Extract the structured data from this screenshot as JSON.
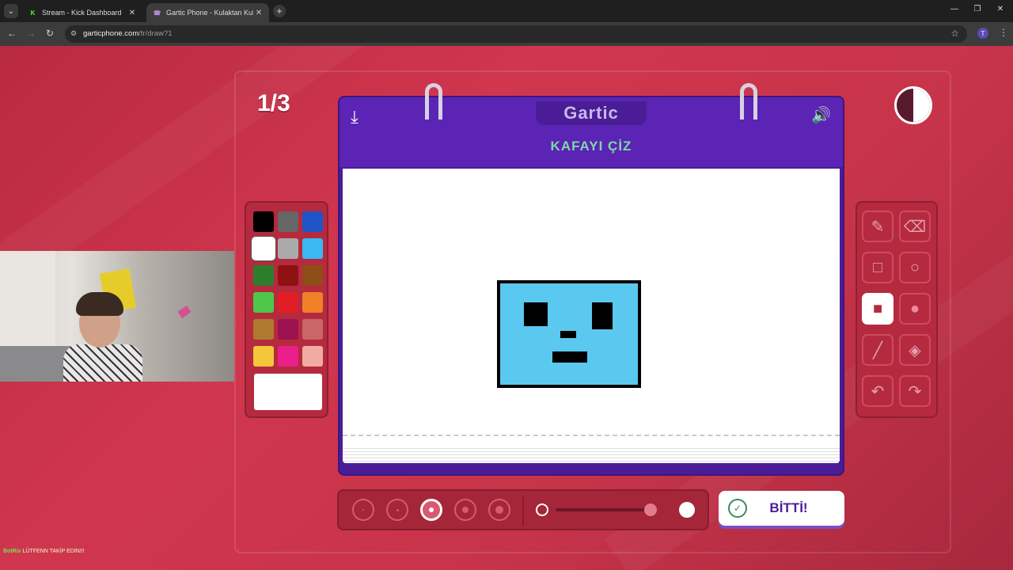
{
  "browser": {
    "tabs": [
      {
        "title": "Stream - Kick Dashboard",
        "favicon": "K",
        "favicon_color": "#53fc18",
        "active": false
      },
      {
        "title": "Gartic Phone - Kulaktan Kulağa",
        "favicon": "☎",
        "favicon_color": "#a98cd6",
        "active": true
      }
    ],
    "url_host": "garticphone.com",
    "url_path": "/tr/draw?1",
    "profile_initial": "T"
  },
  "game": {
    "round": "1/3",
    "logo": "Gartic",
    "prompt": "KAFAYI ÇİZ",
    "done_label": "BİTTİ!",
    "timer_fraction_remaining": 0.5
  },
  "palette": {
    "colors": [
      "#000000",
      "#666666",
      "#1f55c8",
      "#ffffff",
      "#aaaaaa",
      "#39b8f2",
      "#2d7e2c",
      "#8e1212",
      "#8f4d18",
      "#4fc84a",
      "#e21e25",
      "#f08127",
      "#b07a2e",
      "#9c1251",
      "#c96667",
      "#f4c73a",
      "#ec1f8a",
      "#f2aba0"
    ],
    "selected_index": 3,
    "current_color": "#ffffff"
  },
  "tools": {
    "items": [
      "pencil-icon",
      "eraser-icon",
      "rectangle-outline-icon",
      "ellipse-outline-icon",
      "rectangle-fill-icon",
      "ellipse-fill-icon",
      "line-icon",
      "bucket-icon",
      "undo-icon",
      "redo-icon"
    ],
    "selected": "rectangle-fill-icon"
  },
  "brush": {
    "sizes": 5,
    "selected_size_index": 2,
    "opacity_value": 0.9
  },
  "drawing": {
    "fill_color": "#5bc8ef",
    "outline_color": "#000000"
  },
  "overlay": {
    "chat_user": "BotRix",
    "chat_message": "LÜTFENN TAKİP EDİN!!!"
  }
}
